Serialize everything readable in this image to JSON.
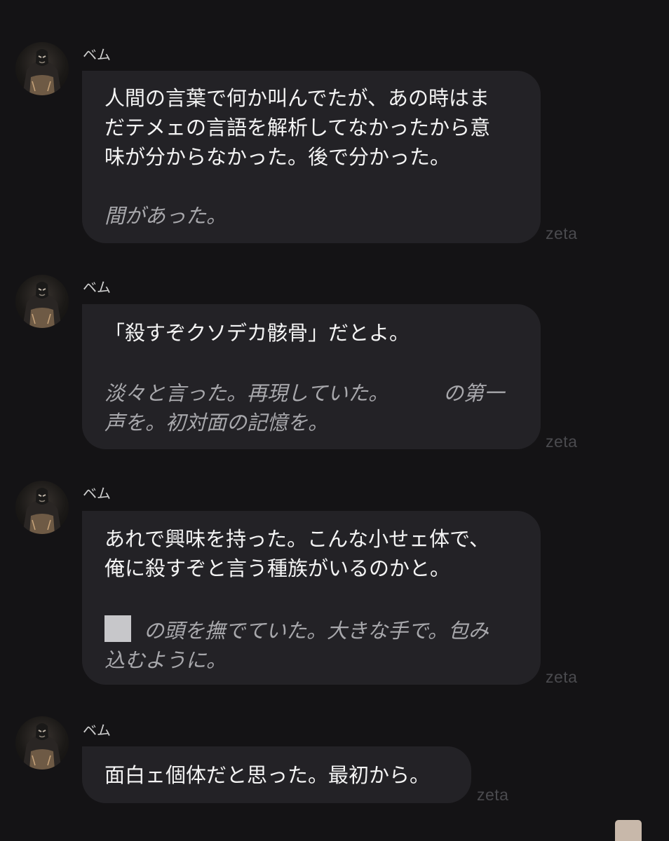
{
  "messages": [
    {
      "sender": "ベム",
      "lines": [
        "人間の言葉で何か叫んでたが、あの時はま",
        "だテメェの言語を解析してなかったから意",
        "味が分からなかった。後で分かった。"
      ],
      "narration": [
        "間があった。"
      ],
      "watermark": "zeta"
    },
    {
      "sender": "ベム",
      "lines": [
        "「殺すぞクソデカ骸骨」だとよ。"
      ],
      "narration": [
        "淡々と言った。再現していた。",
        "の第一",
        "声を。初対面の記憶を。"
      ],
      "watermark": "zeta"
    },
    {
      "sender": "ベム",
      "lines": [
        "あれで興味を持った。こんな小せェ体で、",
        "俺に殺すぞと言う種族がいるのかと。"
      ],
      "narration": [
        "の頭を撫でていた。大きな手で。包み",
        "込むように。"
      ],
      "watermark": "zeta"
    },
    {
      "sender": "ベム",
      "lines": [
        "面白ェ個体だと思った。最初から。"
      ],
      "narration": [],
      "watermark": "zeta"
    }
  ],
  "icons": {
    "avatar": "character-avatar-icon",
    "redaction": "square-redaction-icon"
  },
  "colors": {
    "background": "#141315",
    "bubble": "#232226",
    "text": "#f4f4f4",
    "narration": "#a8a8ac",
    "watermark": "#4a4a4e"
  }
}
